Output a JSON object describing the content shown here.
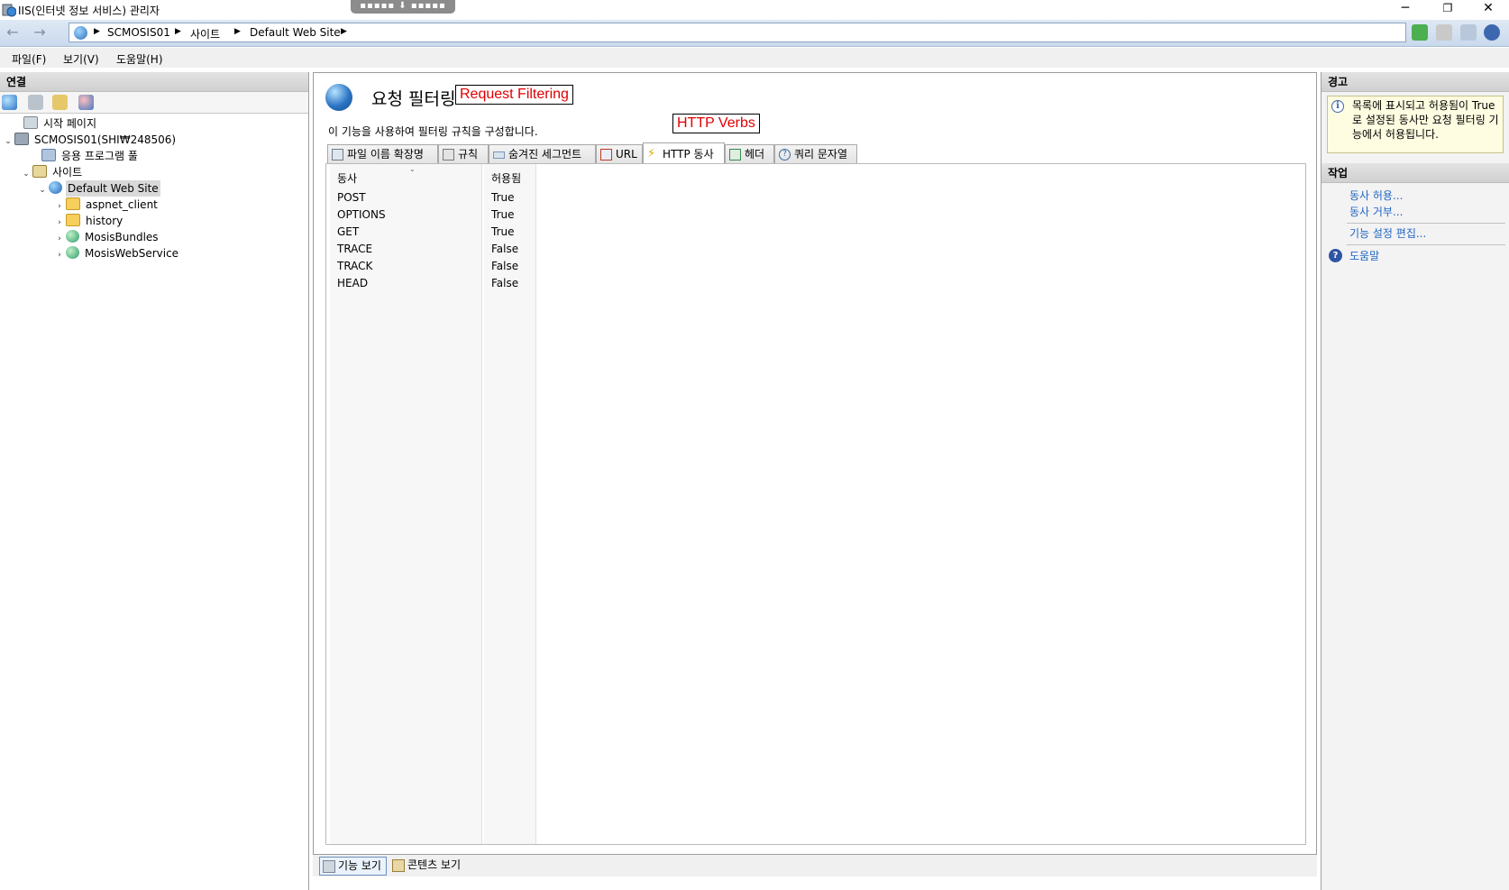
{
  "window": {
    "title": "IIS(인터넷 정보 서비스) 관리자",
    "minimize_glyph": "─",
    "maximize_glyph": "❐",
    "close_glyph": "✕"
  },
  "address": {
    "crumbs": [
      "SCMOSIS01",
      "사이트",
      "Default Web Site"
    ]
  },
  "menu": {
    "file": "파일(F)",
    "view": "보기(V)",
    "help": "도움말(H)"
  },
  "connections": {
    "header": "연결",
    "tree": [
      {
        "label": "시작 페이지",
        "icon": "home-icon"
      },
      {
        "label": "SCMOSIS01(SHI₩248506)",
        "icon": "server-icon"
      },
      {
        "label": "응용 프로그램 풀",
        "icon": "app-pool-icon"
      },
      {
        "label": "사이트",
        "icon": "sites-icon"
      },
      {
        "label": "Default Web Site",
        "icon": "globe-icon"
      },
      {
        "label": "aspnet_client",
        "icon": "folder-icon"
      },
      {
        "label": "history",
        "icon": "folder-icon"
      },
      {
        "label": "MosisBundles",
        "icon": "web-app-icon"
      },
      {
        "label": "MosisWebService",
        "icon": "web-app-icon"
      }
    ]
  },
  "feature": {
    "title": "요청 필터링",
    "description": "이 기능을 사용하여 필터링 규칙을 구성합니다.",
    "annotation_feature": "Request Filtering",
    "annotation_tab": "HTTP Verbs",
    "tabs": [
      {
        "label": "파일 이름 확장명",
        "icon": "file-extension-icon"
      },
      {
        "label": "규칙",
        "icon": "rules-icon"
      },
      {
        "label": "숨겨진 세그먼트",
        "icon": "hidden-segments-icon"
      },
      {
        "label": "URL",
        "icon": "url-icon"
      },
      {
        "label": "HTTP 동사",
        "icon": "http-verbs-icon",
        "active": true
      },
      {
        "label": "헤더",
        "icon": "headers-icon"
      },
      {
        "label": "쿼리 문자열",
        "icon": "query-string-icon"
      }
    ],
    "columns": {
      "verb": "동사",
      "allowed": "허용됨"
    },
    "rows": [
      {
        "verb": "POST",
        "allowed": "True"
      },
      {
        "verb": "OPTIONS",
        "allowed": "True"
      },
      {
        "verb": "GET",
        "allowed": "True"
      },
      {
        "verb": "TRACE",
        "allowed": "False"
      },
      {
        "verb": "TRACK",
        "allowed": "False"
      },
      {
        "verb": "HEAD",
        "allowed": "False"
      }
    ]
  },
  "viewbar": {
    "features_view": "기능 보기",
    "content_view": "콘텐츠 보기"
  },
  "actions": {
    "alerts_header": "경고",
    "alert_text": "목록에 표시되고 허용됨이 True로 설정된 동사만 요청 필터링 기능에서 허용됩니다.",
    "tasks_header": "작업",
    "allow_verb": "동사 허용...",
    "deny_verb": "동사 거부...",
    "edit_settings": "기능 설정 편집...",
    "help": "도움말"
  },
  "colors": {
    "accent_link": "#2166c4",
    "annotation_red": "#e00000"
  }
}
